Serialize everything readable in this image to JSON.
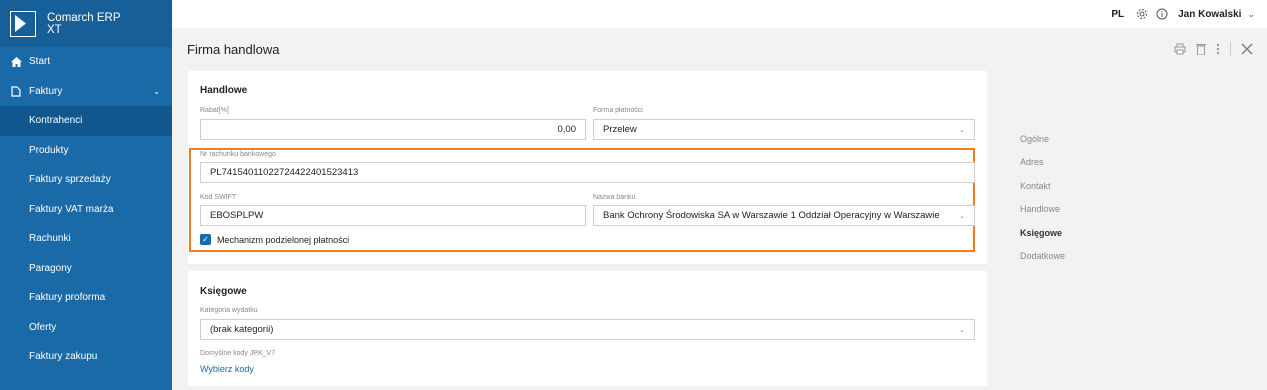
{
  "app": {
    "name_line1": "Comarch ERP",
    "name_line2": "XT"
  },
  "sidebar": {
    "start": "Start",
    "faktury": "Faktury",
    "items": [
      "Kontrahenci",
      "Produkty",
      "Faktury sprzedaży",
      "Faktury VAT marża",
      "Rachunki",
      "Paragony",
      "Faktury proforma",
      "Oferty",
      "Faktury zakupu"
    ]
  },
  "topbar": {
    "lang": "PL",
    "user": "Jan Kowalski"
  },
  "page": {
    "title": "Firma handlowa"
  },
  "handlowe": {
    "title": "Handlowe",
    "rabat_label": "Rabat[%]",
    "rabat_value": "0,00",
    "forma_label": "Forma płatności",
    "forma_value": "Przelew",
    "nr_label": "Nr rachunku bankowego",
    "nr_value": "PL74154011022724422401523413",
    "swift_label": "Kod SWIFT",
    "swift_value": "EBOSPLPW",
    "bank_label": "Nazwa banku",
    "bank_value": "Bank Ochrony Środowiska SA w Warszawie 1 Oddział Operacyjny w Warszawie",
    "mechanizm_label": "Mechanizm podzielonej płatności",
    "mechanizm_checked": true
  },
  "ksiegowe": {
    "title": "Księgowe",
    "kategoria_label": "Kategoria wydatku",
    "kategoria_value": "(brak kategorii)",
    "jpk_label": "Domyślne kody JPK_V7",
    "jpk_link": "Wybierz kody"
  },
  "right_nav": [
    "Ogólne",
    "Adres",
    "Kontakt",
    "Handlowe",
    "Księgowe",
    "Dodatkowe"
  ],
  "colors": {
    "sidebar": "#1a6aa8",
    "highlight": "#ef7d22",
    "link": "#1a6aa8"
  }
}
